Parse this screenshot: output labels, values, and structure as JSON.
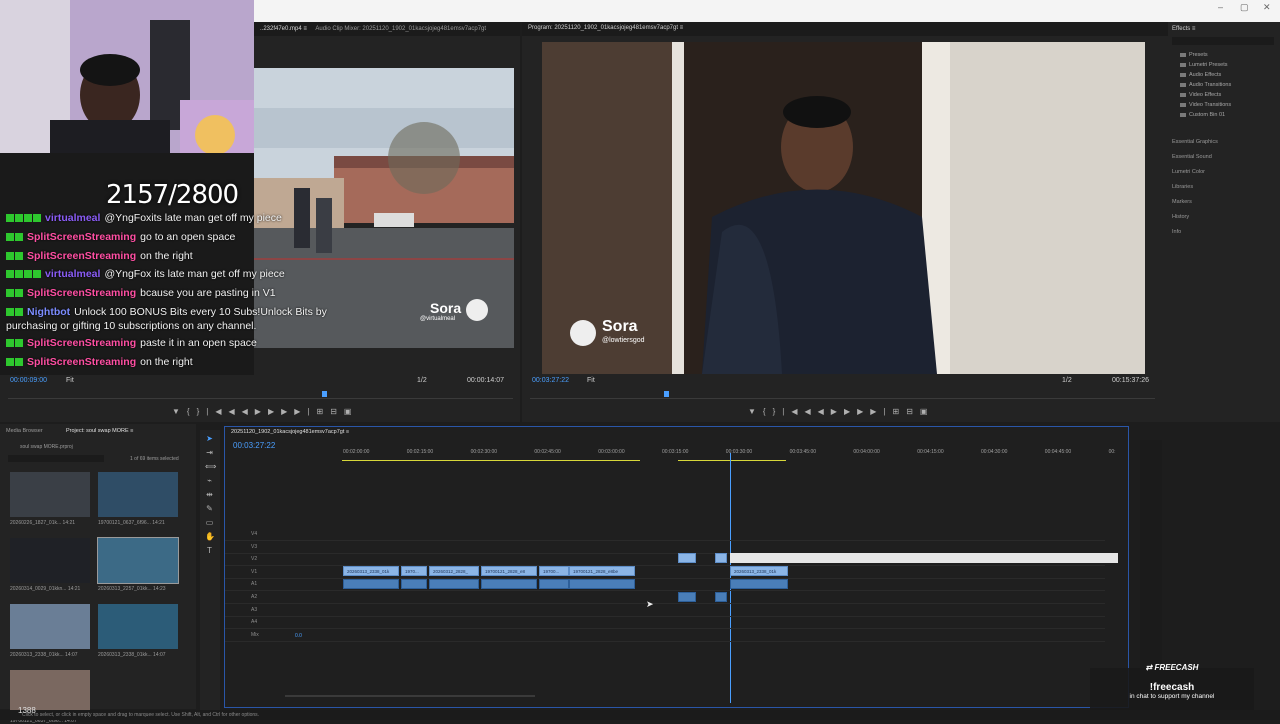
{
  "window": {
    "min": "–",
    "max": "▢",
    "close": "✕"
  },
  "stream": {
    "counter": "2157/2800",
    "chat": [
      {
        "user": "virtualmeal",
        "user_color": "#8a5cf6",
        "msg": "@YngFoxits late man get off my piece",
        "badges": 4
      },
      {
        "user": "SplitScreenStreaming",
        "user_color": "#ff4fa3",
        "msg": "go to an open space",
        "badges": 2
      },
      {
        "user": "SplitScreenStreaming",
        "user_color": "#ff4fa3",
        "msg": "on the right",
        "badges": 2
      },
      {
        "user": "virtualmeal",
        "user_color": "#8a5cf6",
        "msg": "@YngFox its late man get off my piece",
        "badges": 4
      },
      {
        "user": "SplitScreenStreaming",
        "user_color": "#ff4fa3",
        "msg": "bcause you are pasting in V1",
        "badges": 2
      },
      {
        "user": "Nightbot",
        "user_color": "#7c8cff",
        "msg": "Unlock 100 BONUS Bits every 10 Subs!Unlock Bits by",
        "msg2": "purchasing or gifting 10 subscriptions on any channel.",
        "badges": 2
      },
      {
        "user": "SplitScreenStreaming",
        "user_color": "#ff4fa3",
        "msg": "paste it in an open space",
        "badges": 2
      },
      {
        "user": "SplitScreenStreaming",
        "user_color": "#ff4fa3",
        "msg": "on the right",
        "badges": 2
      }
    ],
    "freecash_logo": "⇄ FREECASH",
    "freecash_cmd": "!freecash",
    "freecash_sub": "in chat to support my channel",
    "viewer_count": "1388"
  },
  "source": {
    "tab1": "..232f47e0.mp4 ≡",
    "tab2": "Audio Clip Mixer: 20251120_1902_01kacsjojeg481emsv7acp7gt",
    "timecode": "00:00:09:00",
    "fit": "Fit",
    "zoom": "1/2",
    "duration": "00:00:14:07",
    "watermark": "Sora",
    "watermark_handle": "@virtualmeal"
  },
  "program": {
    "title": "Program: 20251120_1902_01kacsjojeg481emsv7acp7gt ≡",
    "timecode": "00:03:27:22",
    "fit": "Fit",
    "zoom": "1/2",
    "duration": "00:15:37:26",
    "watermark": "Sora",
    "watermark_handle": "@lowtiersgod"
  },
  "effects": {
    "title": "Effects ≡",
    "items": [
      "Presets",
      "Lumetri Presets",
      "Audio Effects",
      "Audio Transitions",
      "Video Effects",
      "Video Transitions",
      "Custom Bin 01"
    ],
    "sections": [
      "Essential Graphics",
      "Essential Sound",
      "Lumetri Color",
      "Libraries",
      "Markers",
      "History",
      "Info"
    ]
  },
  "project": {
    "tab1": "Media Browser",
    "tab2": "Project: soul swap MORE ≡",
    "file": "soul swap MORE.prproj",
    "count": "1 of 69 items selected",
    "thumbs": [
      {
        "cap": "20260226_1827_01k...",
        "dur": "14:21"
      },
      {
        "cap": "19700121_0637_6f96...",
        "dur": "14:21"
      },
      {
        "cap": "20260314_0029_01kkn...",
        "dur": "14:21"
      },
      {
        "cap": "20260313_2257_01kk...",
        "dur": "14:23"
      },
      {
        "cap": "20260313_2338_01kk...",
        "dur": "14:07"
      },
      {
        "cap": "20260313_2338_01kk...",
        "dur": "14:07"
      },
      {
        "cap": "19700121_0637_6f96...",
        "dur": "14:07"
      }
    ]
  },
  "timeline": {
    "tab": "20251120_1902_01kacsjojeg481emsv7acp7gt ≡",
    "timecode": "00:03:27:22",
    "ruler": [
      "00:02:00:00",
      "00:02:15:00",
      "00:02:30:00",
      "00:02:45:00",
      "00:03:00:00",
      "00:03:15:00",
      "00:03:30:00",
      "00:03:45:00",
      "00:04:00:00",
      "00:04:15:00",
      "00:04:30:00",
      "00:04:45:00",
      "00:"
    ],
    "tracks": [
      "V4",
      "V3",
      "V2",
      "V1",
      "A1",
      "A2",
      "A3",
      "A4",
      "Mix"
    ],
    "mix_val": "0.0",
    "clips": [
      {
        "label": "20260313_2338_01k"
      },
      {
        "label": "1970..."
      },
      {
        "label": "20260312_2828_"
      },
      {
        "label": "19700121_2828_e8"
      },
      {
        "label": "19700..."
      },
      {
        "label": "19700121_2828_e8be"
      },
      {
        "label": "20260313_2338_01k"
      }
    ]
  },
  "status": "Click to select, or click in empty space and drag to marquee select. Use Shift, Alt, and Ctrl for other options."
}
